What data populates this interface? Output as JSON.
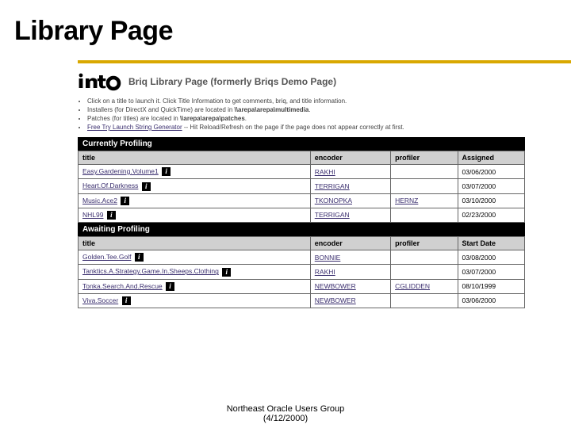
{
  "slide_title": "Library Page",
  "logo_text": "into",
  "page_subtitle": "Briq Library Page (formerly Briqs Demo Page)",
  "bullets": [
    {
      "prefix": "Click on a title to launch it. Click Title Information to get comments, briq, and title information.",
      "path": "",
      "suffix": ""
    },
    {
      "prefix": "Installers (for DirectX and QuickTime) are located in ",
      "path": "\\\\arepa\\arepa\\multimedia",
      "suffix": "."
    },
    {
      "prefix": "Patches (for titles) are located in ",
      "path": "\\\\arepa\\arepa\\patches",
      "suffix": "."
    },
    {
      "link": "Free Try Launch String Generator",
      "after": " -- Hit Reload/Refresh on the page if the page does not appear correctly at first."
    }
  ],
  "section1": {
    "label": "Currently Profiling",
    "headers": {
      "title": "title",
      "encoder": "encoder",
      "profiler": "profiler",
      "date": "Assigned"
    },
    "rows": [
      {
        "title": "Easy.Gardening.Volume1",
        "encoder": "RAKHI",
        "profiler": "",
        "date": "03/06/2000"
      },
      {
        "title": "Heart.Of.Darkness",
        "encoder": "TERRIGAN",
        "profiler": "",
        "date": "03/07/2000"
      },
      {
        "title": "Music.Ace2",
        "encoder": "TKONOPKA",
        "profiler": "HERNZ",
        "date": "03/10/2000"
      },
      {
        "title": "NHL99",
        "encoder": "TERRIGAN",
        "profiler": "",
        "date": "02/23/2000"
      }
    ]
  },
  "section2": {
    "label": "Awaiting Profiling",
    "headers": {
      "title": "title",
      "encoder": "encoder",
      "profiler": "profiler",
      "date": "Start Date"
    },
    "rows": [
      {
        "title": "Golden.Tee.Golf",
        "encoder": "BONNIE",
        "profiler": "",
        "date": "03/08/2000"
      },
      {
        "title": "Tanktics.A.Strategy.Game.In.Sheeps.Clothing",
        "encoder": "RAKHI",
        "profiler": "",
        "date": "03/07/2000"
      },
      {
        "title": "Tonka.Search.And.Rescue",
        "encoder": "NEWBOWER",
        "profiler": "CGLIDDEN",
        "date": "08/10/1999"
      },
      {
        "title": "Viva.Soccer",
        "encoder": "NEWBOWER",
        "profiler": "",
        "date": "03/06/2000"
      }
    ]
  },
  "footer_line1": "Northeast Oracle Users Group",
  "footer_line2": "(4/12/2000)"
}
